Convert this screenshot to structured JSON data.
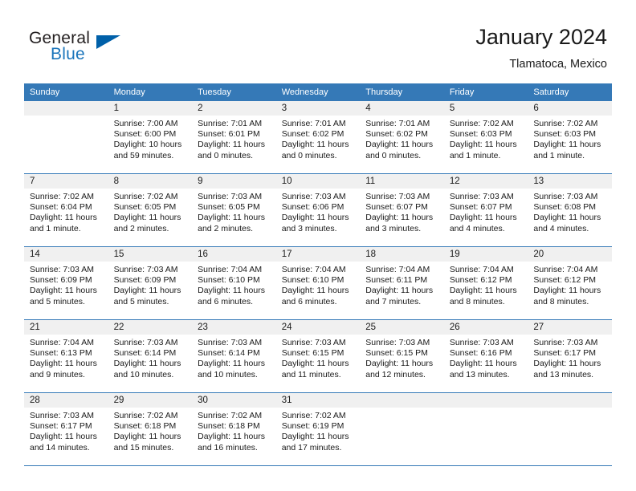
{
  "brand": {
    "word1": "General",
    "word2": "Blue",
    "triangle_color": "#0060a9",
    "blue_color": "#1b75bb"
  },
  "header": {
    "title": "January 2024",
    "subtitle": "Tlamatoca, Mexico",
    "header_bg": "#3579b7",
    "daynum_bg": "#f0f0f0"
  },
  "weekday_headers": [
    "Sunday",
    "Monday",
    "Tuesday",
    "Wednesday",
    "Thursday",
    "Friday",
    "Saturday"
  ],
  "labels": {
    "sunrise_prefix": "Sunrise:",
    "sunset_prefix": "Sunset:",
    "daylight_prefix": "Daylight:"
  },
  "weeks": [
    [
      {
        "day": "",
        "blank": true,
        "sunrise": "",
        "sunset": "",
        "daylight": ""
      },
      {
        "day": "1",
        "sunrise": "Sunrise: 7:00 AM",
        "sunset": "Sunset: 6:00 PM",
        "daylight_line1": "Daylight: 10 hours",
        "daylight_line2": "and 59 minutes."
      },
      {
        "day": "2",
        "sunrise": "Sunrise: 7:01 AM",
        "sunset": "Sunset: 6:01 PM",
        "daylight_line1": "Daylight: 11 hours",
        "daylight_line2": "and 0 minutes."
      },
      {
        "day": "3",
        "sunrise": "Sunrise: 7:01 AM",
        "sunset": "Sunset: 6:02 PM",
        "daylight_line1": "Daylight: 11 hours",
        "daylight_line2": "and 0 minutes."
      },
      {
        "day": "4",
        "sunrise": "Sunrise: 7:01 AM",
        "sunset": "Sunset: 6:02 PM",
        "daylight_line1": "Daylight: 11 hours",
        "daylight_line2": "and 0 minutes."
      },
      {
        "day": "5",
        "sunrise": "Sunrise: 7:02 AM",
        "sunset": "Sunset: 6:03 PM",
        "daylight_line1": "Daylight: 11 hours",
        "daylight_line2": "and 1 minute."
      },
      {
        "day": "6",
        "sunrise": "Sunrise: 7:02 AM",
        "sunset": "Sunset: 6:03 PM",
        "daylight_line1": "Daylight: 11 hours",
        "daylight_line2": "and 1 minute."
      }
    ],
    [
      {
        "day": "7",
        "sunrise": "Sunrise: 7:02 AM",
        "sunset": "Sunset: 6:04 PM",
        "daylight_line1": "Daylight: 11 hours",
        "daylight_line2": "and 1 minute."
      },
      {
        "day": "8",
        "sunrise": "Sunrise: 7:02 AM",
        "sunset": "Sunset: 6:05 PM",
        "daylight_line1": "Daylight: 11 hours",
        "daylight_line2": "and 2 minutes."
      },
      {
        "day": "9",
        "sunrise": "Sunrise: 7:03 AM",
        "sunset": "Sunset: 6:05 PM",
        "daylight_line1": "Daylight: 11 hours",
        "daylight_line2": "and 2 minutes."
      },
      {
        "day": "10",
        "sunrise": "Sunrise: 7:03 AM",
        "sunset": "Sunset: 6:06 PM",
        "daylight_line1": "Daylight: 11 hours",
        "daylight_line2": "and 3 minutes."
      },
      {
        "day": "11",
        "sunrise": "Sunrise: 7:03 AM",
        "sunset": "Sunset: 6:07 PM",
        "daylight_line1": "Daylight: 11 hours",
        "daylight_line2": "and 3 minutes."
      },
      {
        "day": "12",
        "sunrise": "Sunrise: 7:03 AM",
        "sunset": "Sunset: 6:07 PM",
        "daylight_line1": "Daylight: 11 hours",
        "daylight_line2": "and 4 minutes."
      },
      {
        "day": "13",
        "sunrise": "Sunrise: 7:03 AM",
        "sunset": "Sunset: 6:08 PM",
        "daylight_line1": "Daylight: 11 hours",
        "daylight_line2": "and 4 minutes."
      }
    ],
    [
      {
        "day": "14",
        "sunrise": "Sunrise: 7:03 AM",
        "sunset": "Sunset: 6:09 PM",
        "daylight_line1": "Daylight: 11 hours",
        "daylight_line2": "and 5 minutes."
      },
      {
        "day": "15",
        "sunrise": "Sunrise: 7:03 AM",
        "sunset": "Sunset: 6:09 PM",
        "daylight_line1": "Daylight: 11 hours",
        "daylight_line2": "and 5 minutes."
      },
      {
        "day": "16",
        "sunrise": "Sunrise: 7:04 AM",
        "sunset": "Sunset: 6:10 PM",
        "daylight_line1": "Daylight: 11 hours",
        "daylight_line2": "and 6 minutes."
      },
      {
        "day": "17",
        "sunrise": "Sunrise: 7:04 AM",
        "sunset": "Sunset: 6:10 PM",
        "daylight_line1": "Daylight: 11 hours",
        "daylight_line2": "and 6 minutes."
      },
      {
        "day": "18",
        "sunrise": "Sunrise: 7:04 AM",
        "sunset": "Sunset: 6:11 PM",
        "daylight_line1": "Daylight: 11 hours",
        "daylight_line2": "and 7 minutes."
      },
      {
        "day": "19",
        "sunrise": "Sunrise: 7:04 AM",
        "sunset": "Sunset: 6:12 PM",
        "daylight_line1": "Daylight: 11 hours",
        "daylight_line2": "and 8 minutes."
      },
      {
        "day": "20",
        "sunrise": "Sunrise: 7:04 AM",
        "sunset": "Sunset: 6:12 PM",
        "daylight_line1": "Daylight: 11 hours",
        "daylight_line2": "and 8 minutes."
      }
    ],
    [
      {
        "day": "21",
        "sunrise": "Sunrise: 7:04 AM",
        "sunset": "Sunset: 6:13 PM",
        "daylight_line1": "Daylight: 11 hours",
        "daylight_line2": "and 9 minutes."
      },
      {
        "day": "22",
        "sunrise": "Sunrise: 7:03 AM",
        "sunset": "Sunset: 6:14 PM",
        "daylight_line1": "Daylight: 11 hours",
        "daylight_line2": "and 10 minutes."
      },
      {
        "day": "23",
        "sunrise": "Sunrise: 7:03 AM",
        "sunset": "Sunset: 6:14 PM",
        "daylight_line1": "Daylight: 11 hours",
        "daylight_line2": "and 10 minutes."
      },
      {
        "day": "24",
        "sunrise": "Sunrise: 7:03 AM",
        "sunset": "Sunset: 6:15 PM",
        "daylight_line1": "Daylight: 11 hours",
        "daylight_line2": "and 11 minutes."
      },
      {
        "day": "25",
        "sunrise": "Sunrise: 7:03 AM",
        "sunset": "Sunset: 6:15 PM",
        "daylight_line1": "Daylight: 11 hours",
        "daylight_line2": "and 12 minutes."
      },
      {
        "day": "26",
        "sunrise": "Sunrise: 7:03 AM",
        "sunset": "Sunset: 6:16 PM",
        "daylight_line1": "Daylight: 11 hours",
        "daylight_line2": "and 13 minutes."
      },
      {
        "day": "27",
        "sunrise": "Sunrise: 7:03 AM",
        "sunset": "Sunset: 6:17 PM",
        "daylight_line1": "Daylight: 11 hours",
        "daylight_line2": "and 13 minutes."
      }
    ],
    [
      {
        "day": "28",
        "sunrise": "Sunrise: 7:03 AM",
        "sunset": "Sunset: 6:17 PM",
        "daylight_line1": "Daylight: 11 hours",
        "daylight_line2": "and 14 minutes."
      },
      {
        "day": "29",
        "sunrise": "Sunrise: 7:02 AM",
        "sunset": "Sunset: 6:18 PM",
        "daylight_line1": "Daylight: 11 hours",
        "daylight_line2": "and 15 minutes."
      },
      {
        "day": "30",
        "sunrise": "Sunrise: 7:02 AM",
        "sunset": "Sunset: 6:18 PM",
        "daylight_line1": "Daylight: 11 hours",
        "daylight_line2": "and 16 minutes."
      },
      {
        "day": "31",
        "sunrise": "Sunrise: 7:02 AM",
        "sunset": "Sunset: 6:19 PM",
        "daylight_line1": "Daylight: 11 hours",
        "daylight_line2": "and 17 minutes."
      },
      {
        "day": "",
        "blank": true,
        "sunrise": "",
        "sunset": "",
        "daylight": ""
      },
      {
        "day": "",
        "blank": true,
        "sunrise": "",
        "sunset": "",
        "daylight": ""
      },
      {
        "day": "",
        "blank": true,
        "sunrise": "",
        "sunset": "",
        "daylight": ""
      }
    ]
  ]
}
